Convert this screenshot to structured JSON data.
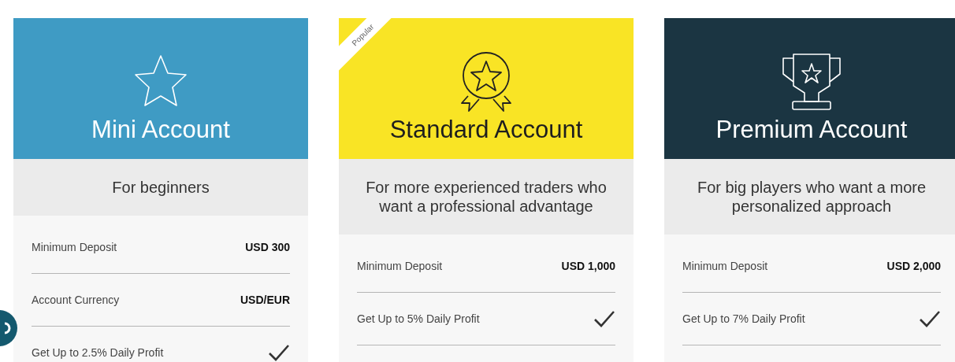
{
  "plans": [
    {
      "kind": "mini",
      "title": "Mini Account",
      "tagline": "For beginners",
      "popular": false,
      "rows": [
        {
          "kind": "value",
          "label": "Minimum Deposit",
          "value": "USD 300"
        },
        {
          "kind": "value",
          "label": "Account Currency",
          "value": "USD/EUR"
        },
        {
          "kind": "check",
          "label": "Get Up to 2.5% Daily Profit",
          "checked": true
        }
      ]
    },
    {
      "kind": "standard",
      "title": "Standard Account",
      "tagline": "For more experienced traders who want a professional advantage",
      "popular": true,
      "badge": "Popular",
      "rows": [
        {
          "kind": "value",
          "label": "Minimum Deposit",
          "value": "USD 1,000"
        },
        {
          "kind": "check",
          "label": "Get Up to 5% Daily Profit",
          "checked": true
        }
      ]
    },
    {
      "kind": "premium",
      "title": "Premium Account",
      "tagline": "For big players who want a more personalized approach",
      "popular": false,
      "rows": [
        {
          "kind": "value",
          "label": "Minimum Deposit",
          "value": "USD 2,000"
        },
        {
          "kind": "check",
          "label": "Get Up to 7% Daily Profit",
          "checked": true
        }
      ]
    }
  ]
}
